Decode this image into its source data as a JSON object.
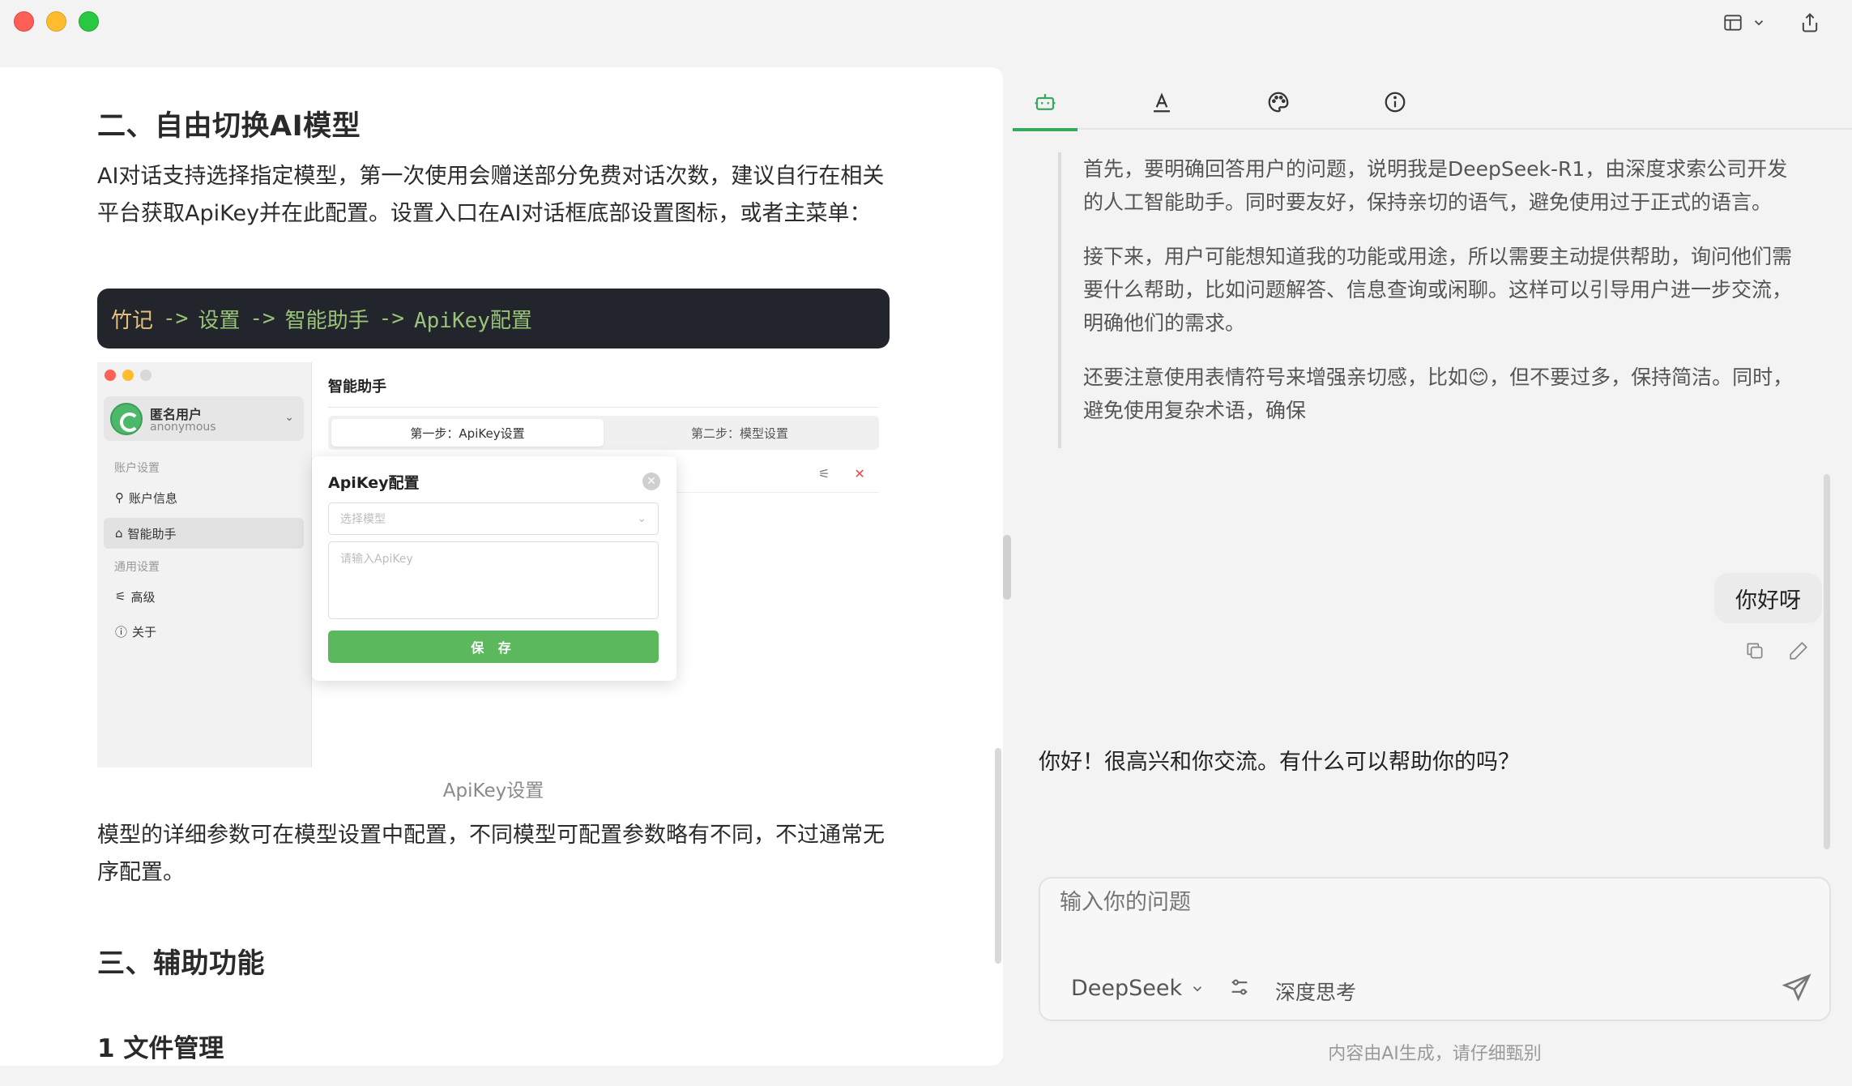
{
  "window": {
    "traffic_lights": [
      "close",
      "minimize",
      "maximize"
    ],
    "colors": {
      "close": "#fe5f57",
      "minimize": "#febc2e",
      "maximize": "#28c840"
    }
  },
  "toolbar": {
    "layout_icon": "layout-panel-icon",
    "share_icon": "share-icon"
  },
  "doc": {
    "heading2": "二、自由切换AI模型",
    "para1": "AI对话支持选择指定模型，第一次使用会赠送部分免费对话次数，建议自行在相关平台获取ApiKey并在此配置。设置入口在AI对话框底部设置图标，或者主菜单：",
    "code": {
      "app": "竹记",
      "arrow": "->",
      "items": [
        "设置",
        "智能助手",
        "ApiKey配置"
      ]
    },
    "screenshot": {
      "user_name": "匿名用户",
      "user_id": "anonymous",
      "section_account": "账户设置",
      "item_account_info": "账户信息",
      "item_assistant": "智能助手",
      "section_general": "通用设置",
      "item_advanced": "高级",
      "item_about": "关于",
      "page_title": "智能助手",
      "step1": "第一步：ApiKey设置",
      "step2": "第二步：模型设置",
      "modal_title": "ApiKey配置",
      "select_placeholder": "选择模型",
      "apikey_placeholder": "请输入ApiKey",
      "save_label": "保 存"
    },
    "caption": "ApiKey设置",
    "para2": "模型的详细参数可在模型设置中配置，不同模型可配置参数略有不同，不过通常无序配置。",
    "heading3": "三、辅助功能",
    "heading4": "1 文件管理",
    "code_colors": {
      "background": "#22252b",
      "app": "#e5c07b",
      "path": "#98c379"
    }
  },
  "chat": {
    "tabs": [
      "assistant-robot-icon",
      "text-format-icon",
      "palette-icon",
      "info-icon"
    ],
    "active_tab": 0,
    "accent": "#3aa85a",
    "thinking": [
      "首先，要明确回答用户的问题，说明我是DeepSeek-R1，由深度求索公司开发的人工智能助手。同时要友好，保持亲切的语气，避免使用过于正式的语言。",
      "接下来，用户可能想知道我的功能或用途，所以需要主动提供帮助，询问他们需要什么帮助，比如问题解答、信息查询或闲聊。这样可以引导用户进一步交流，明确他们的需求。",
      "还要注意使用表情符号来增强亲切感，比如😊，但不要过多，保持简洁。同时，避免使用复杂术语，确保"
    ],
    "user_message": "你好呀",
    "ai_reply": "你好！很高兴和你交流。有什么可以帮助你的吗？",
    "input_placeholder": "输入你的问题",
    "model": "DeepSeek",
    "deep_think": "深度思考",
    "disclaimer": "内容由AI生成，请仔细甄别"
  }
}
